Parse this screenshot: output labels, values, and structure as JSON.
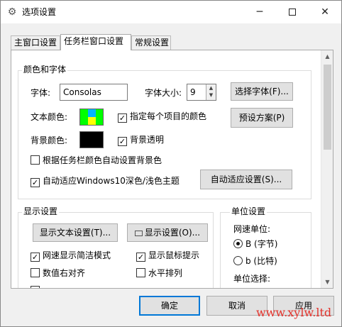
{
  "window": {
    "title": "选项设置",
    "title_icon": "gear-icon"
  },
  "tabs": [
    {
      "label": "主窗口设置",
      "active": false
    },
    {
      "label": "任务栏窗口设置",
      "active": true
    },
    {
      "label": "常规设置",
      "active": false
    }
  ],
  "color_font": {
    "group_title": "颜色和字体",
    "font_label": "字体:",
    "font_value": "Consolas",
    "font_size_label": "字体大小:",
    "font_size_value": "9",
    "choose_font_button": "选择字体(F)...",
    "text_color_label": "文本颜色:",
    "per_item_color": {
      "label": "指定每个项目的颜色",
      "checked": true
    },
    "preset_button": "预设方案(P)",
    "bg_color_label": "背景颜色:",
    "bg_transparent": {
      "label": "背景透明",
      "checked": true
    },
    "auto_bg_by_taskbar": {
      "label": "根据任务栏颜色自动设置背景色",
      "checked": false
    },
    "auto_theme": {
      "label": "自动适应Windows10深色/浅色主题",
      "checked": true
    },
    "auto_theme_button": "自动适应设置(S)...",
    "colors": {
      "text_swatch": [
        "#00ff00",
        "#00b4ff",
        "#ffff00"
      ],
      "bg_swatch": "#000000"
    }
  },
  "display": {
    "group_title": "显示设置",
    "show_text_button": "显示文本设置(T)...",
    "display_settings_button": "显示设置(O)...",
    "display_settings_icon": "grid-icon",
    "speed_simple": {
      "label": "网速显示简洁模式",
      "checked": true
    },
    "mouse_tooltip": {
      "label": "显示鼠标提示",
      "checked": true
    },
    "value_right_align": {
      "label": "数值右对齐",
      "checked": false
    },
    "horizontal": {
      "label": "水平排列",
      "checked": false
    }
  },
  "units": {
    "group_title": "单位设置",
    "speed_unit_label": "网速单位:",
    "options": [
      {
        "label": "B (字节)",
        "selected": true
      },
      {
        "label": "b (比特)",
        "selected": false
      }
    ],
    "unit_select_label": "单位选择:"
  },
  "footer": {
    "ok": "确定",
    "cancel": "取消",
    "apply": "应用"
  },
  "watermark": "www.xylw.ltd"
}
